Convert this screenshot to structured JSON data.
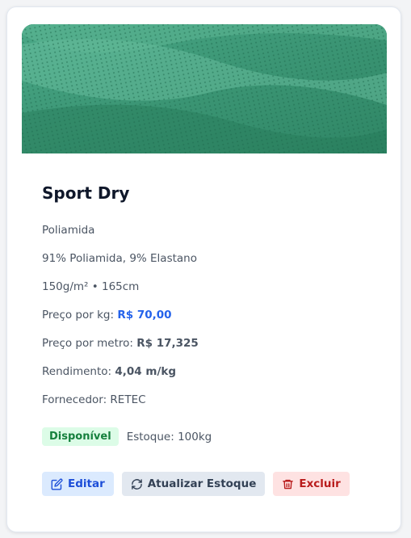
{
  "material": {
    "name": "Sport Dry",
    "composition_type": "Poliamida",
    "composition": "91% Poliamida, 9% Elastano",
    "specs": "150g/m² • 165cm",
    "price_kg_label": "Preço por kg: ",
    "price_kg_value": "R$ 70,00",
    "price_m_label": "Preço por metro: ",
    "price_m_value": "R$ 17,325",
    "yield_label": "Rendimento: ",
    "yield_value": "4,04 m/kg",
    "supplier": "Fornecedor: RETEC"
  },
  "status": {
    "badge": "Disponível",
    "stock": "Estoque: 100kg"
  },
  "actions": {
    "edit": "Editar",
    "update_stock": "Atualizar Estoque",
    "delete": "Excluir"
  },
  "colors": {
    "accent_blue": "#2563eb",
    "available_green": "#15803d",
    "danger_red": "#b91c1c",
    "fabric_green": "#3f9b7a"
  },
  "icons": {
    "edit": "edit-icon",
    "update_stock": "refresh-icon",
    "delete": "trash-icon"
  }
}
